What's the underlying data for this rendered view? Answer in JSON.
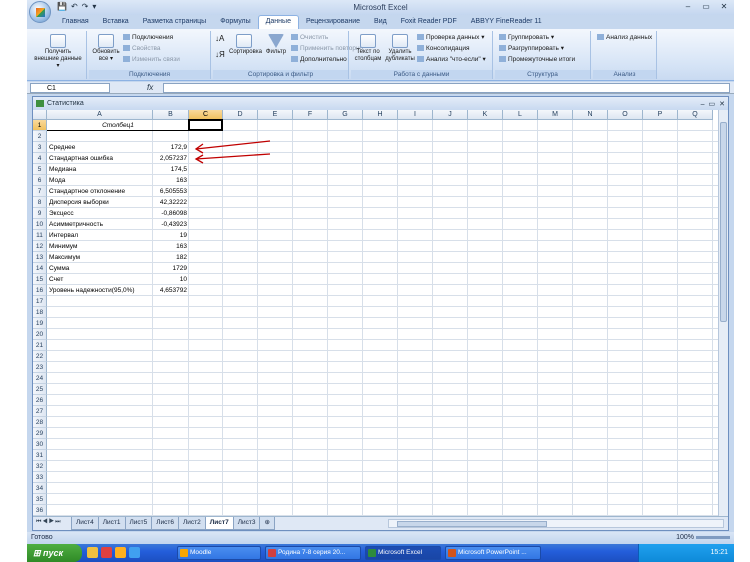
{
  "app": {
    "title": "Microsoft Excel",
    "qat": [
      "💾",
      "↶",
      "↷",
      "▾"
    ],
    "win_controls": [
      "–",
      "▭",
      "✕"
    ]
  },
  "ribbon": {
    "tabs": [
      "Главная",
      "Вставка",
      "Разметка страницы",
      "Формулы",
      "Данные",
      "Рецензирование",
      "Вид",
      "Foxit Reader PDF",
      "ABBYY FineReader 11"
    ],
    "active_tab": "Данные",
    "groups": {
      "external": {
        "label": "",
        "button": "Получить внешние данные ▾"
      },
      "connections": {
        "label": "Подключения",
        "refresh": "Обновить все ▾",
        "items": [
          "Подключения",
          "Свойства",
          "Изменить связи"
        ]
      },
      "sort": {
        "label": "Сортировка и фильтр",
        "sort_button": "Сортировка",
        "filter_button": "Фильтр",
        "items": [
          "Очистить",
          "Применить повторно",
          "Дополнительно"
        ]
      },
      "data_tools": {
        "label": "Работа с данными",
        "text_to_cols": "Текст по столбцам",
        "dedupe": "Удалить дубликаты",
        "items": [
          "Проверка данных ▾",
          "Консолидация",
          "Анализ \"что-если\" ▾"
        ]
      },
      "outline": {
        "label": "Структура",
        "items": [
          "Группировать ▾",
          "Разгруппировать ▾",
          "Промежуточные итоги"
        ]
      },
      "analysis": {
        "label": "Анализ",
        "item": "Анализ данных"
      }
    }
  },
  "formula_bar": {
    "name_box": "C1",
    "fx": "fx",
    "value": ""
  },
  "workbook": {
    "title": "Статистика",
    "controls": [
      "–",
      "▭",
      "✕"
    ],
    "columns": [
      "A",
      "B",
      "C",
      "D",
      "E",
      "F",
      "G",
      "H",
      "I",
      "J",
      "K",
      "L",
      "M",
      "N",
      "O",
      "P",
      "Q"
    ],
    "rows": [
      "1",
      "2",
      "3",
      "4",
      "5",
      "6",
      "7",
      "8",
      "9",
      "10",
      "11",
      "12",
      "13",
      "14",
      "15",
      "16",
      "17",
      "18",
      "19",
      "20",
      "21",
      "22",
      "23",
      "24",
      "25",
      "26",
      "27",
      "28",
      "29",
      "30",
      "31",
      "32",
      "33",
      "34",
      "35",
      "36"
    ],
    "header_cell": "Столбец1",
    "stats": [
      {
        "label": "Среднее",
        "value": "172,9"
      },
      {
        "label": "Стандартная ошибка",
        "value": "2,057237"
      },
      {
        "label": "Медиана",
        "value": "174,5"
      },
      {
        "label": "Мода",
        "value": "163"
      },
      {
        "label": "Стандартное отклонение",
        "value": "6,505553"
      },
      {
        "label": "Дисперсия выборки",
        "value": "42,32222"
      },
      {
        "label": "Эксцесс",
        "value": "-0,86098"
      },
      {
        "label": "Асимметричность",
        "value": "-0,43923"
      },
      {
        "label": "Интервал",
        "value": "19"
      },
      {
        "label": "Минимум",
        "value": "163"
      },
      {
        "label": "Максимум",
        "value": "182"
      },
      {
        "label": "Сумма",
        "value": "1729"
      },
      {
        "label": "Счет",
        "value": "10"
      },
      {
        "label": "Уровень надежности(95,0%)",
        "value": "4,653792"
      }
    ],
    "sheet_nav": "⏮◀▶⏭",
    "sheets": [
      "Лист4",
      "Лист1",
      "Лист5",
      "Лист6",
      "Лист2",
      "Лист7",
      "Лист3"
    ],
    "active_sheet": "Лист7"
  },
  "status": {
    "text": "Готово",
    "zoom": "100%"
  },
  "taskbar": {
    "start": "пуск",
    "tasks": [
      "Moodle",
      "Родина 7-8 серия 20...",
      "Microsoft Excel",
      "Microsoft PowerPoint ..."
    ],
    "clock": "15:21"
  },
  "colors": {
    "accent": "#c00000",
    "ribbon": "#d6e4f6",
    "selection": "#f1c15f"
  }
}
